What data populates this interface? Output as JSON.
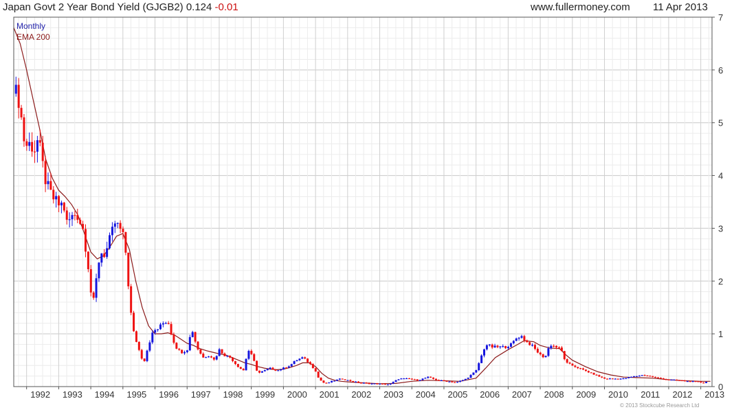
{
  "header": {
    "title": "Japan Govt 2 Year Bond Yield (GJGB2) 0.124",
    "change": "-0.01",
    "site": "www.fullermoney.com",
    "date": "11 Apr 2013"
  },
  "legend": {
    "interval": "Monthly",
    "ma": "EMA 200"
  },
  "copyright": "© 2013 Stockcube Research Ltd",
  "colors": {
    "up": "#1515dd",
    "down": "#ee1111",
    "ema": "#8b1a1a",
    "grid": "#dddddd",
    "frame": "#555555"
  },
  "chart_data": {
    "type": "candlestick",
    "title": "Japan Govt 2 Year Bond Yield (GJGB2)",
    "interval": "Monthly",
    "xlim": [
      1991.6,
      2013.35
    ],
    "ylim": [
      0,
      7
    ],
    "y_ticks": [
      "0",
      "1",
      "2",
      "3",
      "4",
      "5",
      "6",
      "7"
    ],
    "x_ticks": [
      "1992",
      "1993",
      "1994",
      "1995",
      "1996",
      "1997",
      "1998",
      "1999",
      "2000",
      "2001",
      "2002",
      "2003",
      "2004",
      "2005",
      "2006",
      "2007",
      "2008",
      "2009",
      "2010",
      "2011",
      "2012",
      "2013"
    ],
    "grid": true,
    "series": [
      {
        "name": "Monthly",
        "anchors": [
          [
            1991.67,
            5.55
          ],
          [
            1991.75,
            5.47
          ],
          [
            1991.85,
            5.02
          ],
          [
            1991.95,
            4.55
          ],
          [
            1992.05,
            4.6
          ],
          [
            1992.15,
            4.58
          ],
          [
            1992.25,
            4.5
          ],
          [
            1992.35,
            4.68
          ],
          [
            1992.45,
            4.38
          ],
          [
            1992.55,
            4.0
          ],
          [
            1992.7,
            3.7
          ],
          [
            1992.85,
            3.55
          ],
          [
            1993.0,
            3.45
          ],
          [
            1993.15,
            3.45
          ],
          [
            1993.25,
            3.1
          ],
          [
            1993.4,
            3.2
          ],
          [
            1993.55,
            3.3
          ],
          [
            1993.75,
            3.0
          ],
          [
            1993.9,
            2.4
          ],
          [
            1994.0,
            1.8
          ],
          [
            1994.1,
            1.6
          ],
          [
            1994.2,
            2.2
          ],
          [
            1994.3,
            2.55
          ],
          [
            1994.45,
            2.5
          ],
          [
            1994.6,
            2.8
          ],
          [
            1994.75,
            3.1
          ],
          [
            1994.9,
            3.0
          ],
          [
            1995.0,
            2.85
          ],
          [
            1995.1,
            2.5
          ],
          [
            1995.2,
            1.7
          ],
          [
            1995.3,
            1.1
          ],
          [
            1995.4,
            0.9
          ],
          [
            1995.55,
            0.6
          ],
          [
            1995.65,
            0.45
          ],
          [
            1995.8,
            0.8
          ],
          [
            1995.95,
            1.05
          ],
          [
            1996.1,
            1.1
          ],
          [
            1996.25,
            1.2
          ],
          [
            1996.4,
            1.25
          ],
          [
            1996.55,
            0.9
          ],
          [
            1996.7,
            0.7
          ],
          [
            1996.85,
            0.65
          ],
          [
            1997.0,
            0.7
          ],
          [
            1997.15,
            1.1
          ],
          [
            1997.3,
            0.75
          ],
          [
            1997.5,
            0.55
          ],
          [
            1997.7,
            0.6
          ],
          [
            1997.85,
            0.5
          ],
          [
            1998.0,
            0.7
          ],
          [
            1998.15,
            0.6
          ],
          [
            1998.35,
            0.55
          ],
          [
            1998.55,
            0.4
          ],
          [
            1998.75,
            0.3
          ],
          [
            1998.9,
            0.7
          ],
          [
            1999.05,
            0.55
          ],
          [
            1999.2,
            0.25
          ],
          [
            1999.4,
            0.3
          ],
          [
            1999.6,
            0.35
          ],
          [
            1999.8,
            0.3
          ],
          [
            2000.0,
            0.35
          ],
          [
            2000.2,
            0.4
          ],
          [
            2000.4,
            0.5
          ],
          [
            2000.6,
            0.55
          ],
          [
            2000.8,
            0.45
          ],
          [
            2001.0,
            0.3
          ],
          [
            2001.1,
            0.15
          ],
          [
            2001.3,
            0.05
          ],
          [
            2001.5,
            0.1
          ],
          [
            2001.8,
            0.15
          ],
          [
            2002.0,
            0.12
          ],
          [
            2002.3,
            0.08
          ],
          [
            2002.6,
            0.06
          ],
          [
            2003.0,
            0.05
          ],
          [
            2003.3,
            0.04
          ],
          [
            2003.6,
            0.15
          ],
          [
            2003.9,
            0.15
          ],
          [
            2004.2,
            0.12
          ],
          [
            2004.5,
            0.18
          ],
          [
            2004.8,
            0.12
          ],
          [
            2005.1,
            0.1
          ],
          [
            2005.4,
            0.08
          ],
          [
            2005.7,
            0.15
          ],
          [
            2006.0,
            0.3
          ],
          [
            2006.15,
            0.55
          ],
          [
            2006.3,
            0.8
          ],
          [
            2006.5,
            0.75
          ],
          [
            2006.7,
            0.75
          ],
          [
            2006.9,
            0.75
          ],
          [
            2007.1,
            0.8
          ],
          [
            2007.3,
            0.95
          ],
          [
            2007.45,
            0.95
          ],
          [
            2007.55,
            0.85
          ],
          [
            2007.7,
            0.8
          ],
          [
            2007.85,
            0.7
          ],
          [
            2008.0,
            0.6
          ],
          [
            2008.15,
            0.55
          ],
          [
            2008.3,
            0.8
          ],
          [
            2008.5,
            0.75
          ],
          [
            2008.65,
            0.7
          ],
          [
            2008.8,
            0.45
          ],
          [
            2009.0,
            0.4
          ],
          [
            2009.2,
            0.35
          ],
          [
            2009.4,
            0.3
          ],
          [
            2009.6,
            0.25
          ],
          [
            2009.8,
            0.2
          ],
          [
            2010.0,
            0.15
          ],
          [
            2010.2,
            0.15
          ],
          [
            2010.4,
            0.15
          ],
          [
            2010.6,
            0.15
          ],
          [
            2010.8,
            0.18
          ],
          [
            2011.0,
            0.2
          ],
          [
            2011.2,
            0.22
          ],
          [
            2011.4,
            0.2
          ],
          [
            2011.6,
            0.17
          ],
          [
            2011.8,
            0.15
          ],
          [
            2012.0,
            0.13
          ],
          [
            2012.3,
            0.12
          ],
          [
            2012.6,
            0.1
          ],
          [
            2012.9,
            0.09
          ],
          [
            2013.1,
            0.07
          ],
          [
            2013.25,
            0.12
          ]
        ]
      },
      {
        "name": "EMA 200",
        "values": [
          [
            1991.6,
            6.8
          ],
          [
            1991.8,
            6.5
          ],
          [
            1992.0,
            6.0
          ],
          [
            1992.2,
            5.45
          ],
          [
            1992.4,
            4.9
          ],
          [
            1992.6,
            4.3
          ],
          [
            1992.8,
            3.95
          ],
          [
            1993.0,
            3.72
          ],
          [
            1993.2,
            3.6
          ],
          [
            1993.4,
            3.45
          ],
          [
            1993.6,
            3.25
          ],
          [
            1993.8,
            2.9
          ],
          [
            1994.0,
            2.55
          ],
          [
            1994.2,
            2.42
          ],
          [
            1994.4,
            2.48
          ],
          [
            1994.6,
            2.65
          ],
          [
            1994.8,
            2.85
          ],
          [
            1995.0,
            2.9
          ],
          [
            1995.2,
            2.6
          ],
          [
            1995.4,
            2.0
          ],
          [
            1995.6,
            1.5
          ],
          [
            1995.8,
            1.15
          ],
          [
            1996.0,
            1.0
          ],
          [
            1996.2,
            1.0
          ],
          [
            1996.4,
            1.02
          ],
          [
            1996.6,
            0.98
          ],
          [
            1996.8,
            0.9
          ],
          [
            1997.0,
            0.82
          ],
          [
            1997.2,
            0.78
          ],
          [
            1997.4,
            0.72
          ],
          [
            1997.6,
            0.68
          ],
          [
            1997.8,
            0.65
          ],
          [
            1998.0,
            0.62
          ],
          [
            1998.2,
            0.6
          ],
          [
            1998.4,
            0.55
          ],
          [
            1998.6,
            0.5
          ],
          [
            1998.8,
            0.45
          ],
          [
            1999.0,
            0.42
          ],
          [
            1999.2,
            0.38
          ],
          [
            1999.4,
            0.35
          ],
          [
            1999.6,
            0.33
          ],
          [
            1999.8,
            0.32
          ],
          [
            2000.0,
            0.33
          ],
          [
            2000.2,
            0.36
          ],
          [
            2000.4,
            0.4
          ],
          [
            2000.6,
            0.45
          ],
          [
            2000.8,
            0.45
          ],
          [
            2001.0,
            0.38
          ],
          [
            2001.2,
            0.25
          ],
          [
            2001.4,
            0.16
          ],
          [
            2001.6,
            0.12
          ],
          [
            2001.8,
            0.1
          ],
          [
            2002.0,
            0.09
          ],
          [
            2002.5,
            0.07
          ],
          [
            2003.0,
            0.055
          ],
          [
            2003.5,
            0.06
          ],
          [
            2004.0,
            0.1
          ],
          [
            2004.5,
            0.12
          ],
          [
            2005.0,
            0.11
          ],
          [
            2005.5,
            0.1
          ],
          [
            2006.0,
            0.16
          ],
          [
            2006.3,
            0.35
          ],
          [
            2006.6,
            0.55
          ],
          [
            2007.0,
            0.7
          ],
          [
            2007.3,
            0.8
          ],
          [
            2007.5,
            0.87
          ],
          [
            2007.8,
            0.85
          ],
          [
            2008.0,
            0.78
          ],
          [
            2008.3,
            0.73
          ],
          [
            2008.6,
            0.72
          ],
          [
            2008.8,
            0.6
          ],
          [
            2009.0,
            0.5
          ],
          [
            2009.4,
            0.38
          ],
          [
            2009.8,
            0.28
          ],
          [
            2010.2,
            0.22
          ],
          [
            2010.6,
            0.18
          ],
          [
            2011.0,
            0.17
          ],
          [
            2011.5,
            0.16
          ],
          [
            2012.0,
            0.13
          ],
          [
            2012.5,
            0.11
          ],
          [
            2013.0,
            0.1
          ],
          [
            2013.3,
            0.1
          ]
        ]
      }
    ]
  }
}
